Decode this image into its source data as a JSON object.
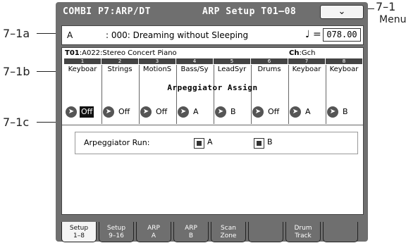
{
  "callouts": {
    "top": "7–1",
    "menu": "Menu",
    "a": "7–1a",
    "b": "7–1b",
    "c": "7–1c"
  },
  "title": {
    "mode": "COMBI P7:ARP/DT",
    "page": "ARP Setup T01–08",
    "menu_icon": "chevron-down-icon"
  },
  "combi": {
    "bank": "A",
    "name": ": 000: Dreaming without Sleeping",
    "tempo_symbol": "♩ =",
    "tempo": "078.00"
  },
  "program": {
    "track": "T01",
    "name": ":A022:Stereo Concert Piano",
    "ch_label": "Ch",
    "ch": ":Gch"
  },
  "tracks": [
    {
      "num": "1",
      "name": "Keyboar",
      "assign": "Off"
    },
    {
      "num": "2",
      "name": "Strings",
      "assign": "Off"
    },
    {
      "num": "3",
      "name": "MotionS",
      "assign": "Off"
    },
    {
      "num": "4",
      "name": "Bass/Sy",
      "assign": "A"
    },
    {
      "num": "5",
      "name": "LeadSyr",
      "assign": "B"
    },
    {
      "num": "6",
      "name": "Drums",
      "assign": "Off"
    },
    {
      "num": "7",
      "name": "Keyboar",
      "assign": "A"
    },
    {
      "num": "8",
      "name": "Keyboar",
      "assign": "B"
    }
  ],
  "assign_title": "Arpeggiator Assign",
  "run": {
    "label": "Arpeggiator Run:",
    "a": "A",
    "b": "B"
  },
  "tabs": [
    {
      "l1": "Setup",
      "l2": "1–8"
    },
    {
      "l1": "Setup",
      "l2": "9–16"
    },
    {
      "l1": "ARP",
      "l2": "A"
    },
    {
      "l1": "ARP",
      "l2": "B"
    },
    {
      "l1": "Scan",
      "l2": "Zone"
    },
    {
      "l1": "",
      "l2": ""
    },
    {
      "l1": "Drum",
      "l2": "Track"
    },
    {
      "l1": "",
      "l2": ""
    }
  ]
}
